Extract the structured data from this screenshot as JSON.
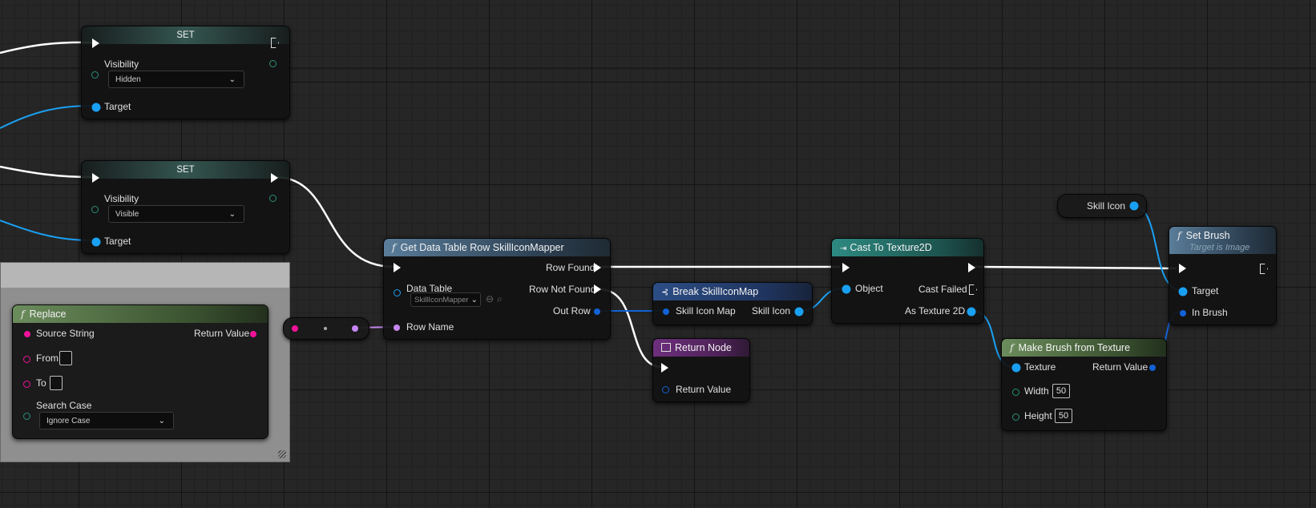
{
  "set_node_1": {
    "title": "SET",
    "visibility_label": "Visibility",
    "visibility_value": "Hidden",
    "target_label": "Target"
  },
  "set_node_2": {
    "title": "SET",
    "visibility_label": "Visibility",
    "visibility_value": "Visible",
    "target_label": "Target"
  },
  "replace_node": {
    "title": "Replace",
    "source_string_label": "Source String",
    "return_value_label": "Return Value",
    "from_label": "From",
    "to_label": "To",
    "search_case_label": "Search Case",
    "search_case_value": "Ignore Case"
  },
  "get_row_node": {
    "title": "Get Data Table Row SkillIconMapper",
    "row_found_label": "Row Found",
    "data_table_label": "Data Table",
    "data_table_value": "SkillIconMapper",
    "row_not_found_label": "Row Not Found",
    "out_row_label": "Out Row",
    "row_name_label": "Row Name"
  },
  "break_node": {
    "title": "Break SkillIconMap",
    "input_label": "Skill Icon Map",
    "output_label": "Skill Icon"
  },
  "return_node": {
    "title": "Return Node",
    "return_value_label": "Return Value"
  },
  "cast_node": {
    "title": "Cast To Texture2D",
    "object_label": "Object",
    "cast_failed_label": "Cast Failed",
    "as_texture_label": "As Texture 2D"
  },
  "make_brush_node": {
    "title": "Make Brush from Texture",
    "texture_label": "Texture",
    "return_value_label": "Return Value",
    "width_label": "Width",
    "width_value": "50",
    "height_label": "Height",
    "height_value": "50"
  },
  "skill_icon_var": {
    "label": "Skill Icon"
  },
  "set_brush_node": {
    "title": "Set Brush",
    "subtitle": "Target is Image",
    "target_label": "Target",
    "in_brush_label": "In Brush"
  },
  "colors": {
    "exec_wire": "#ffffff",
    "object_wire": "#1aa0f2",
    "struct_wire": "#1262d6",
    "string_wire": "#f2129a",
    "name_wire": "#c687f2",
    "grid_background": "#262626"
  },
  "icons": {
    "function": "function-f-icon",
    "cast": "cast-arrow-icon",
    "break": "break-struct-icon",
    "return": "return-node-icon"
  }
}
